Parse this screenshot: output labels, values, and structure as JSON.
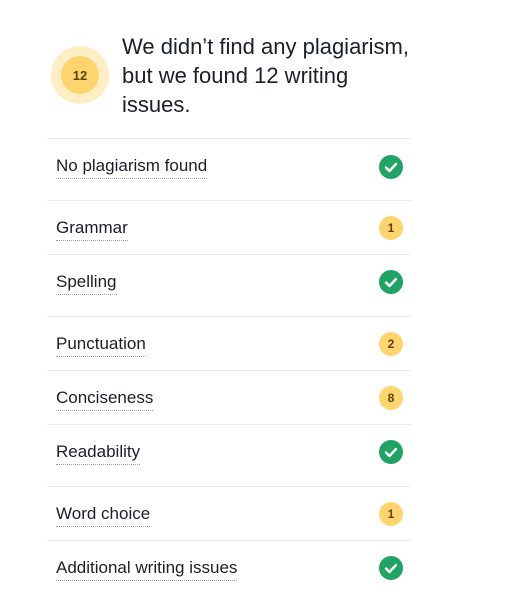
{
  "summary": {
    "issue_count": "12",
    "headline": "We didn’t find any plagiarism, but we found 12 writing issues."
  },
  "checks": [
    {
      "label": "No plagiarism found",
      "status": "ok",
      "icon": "check-circle-icon"
    },
    {
      "label": "Grammar",
      "status": "issues",
      "count": "1"
    },
    {
      "label": "Spelling",
      "status": "ok",
      "icon": "check-circle-icon"
    },
    {
      "label": "Punctuation",
      "status": "issues",
      "count": "2"
    },
    {
      "label": "Conciseness",
      "status": "issues",
      "count": "8"
    },
    {
      "label": "Readability",
      "status": "ok",
      "icon": "check-circle-icon"
    },
    {
      "label": "Word choice",
      "status": "issues",
      "count": "1"
    },
    {
      "label": "Additional writing issues",
      "status": "ok",
      "icon": "check-circle-icon"
    }
  ],
  "colors": {
    "ok_green": "#21a366",
    "badge_yellow": "#fdd46e",
    "badge_yellow_light": "#fdeec4",
    "divider": "#e9eaee"
  }
}
